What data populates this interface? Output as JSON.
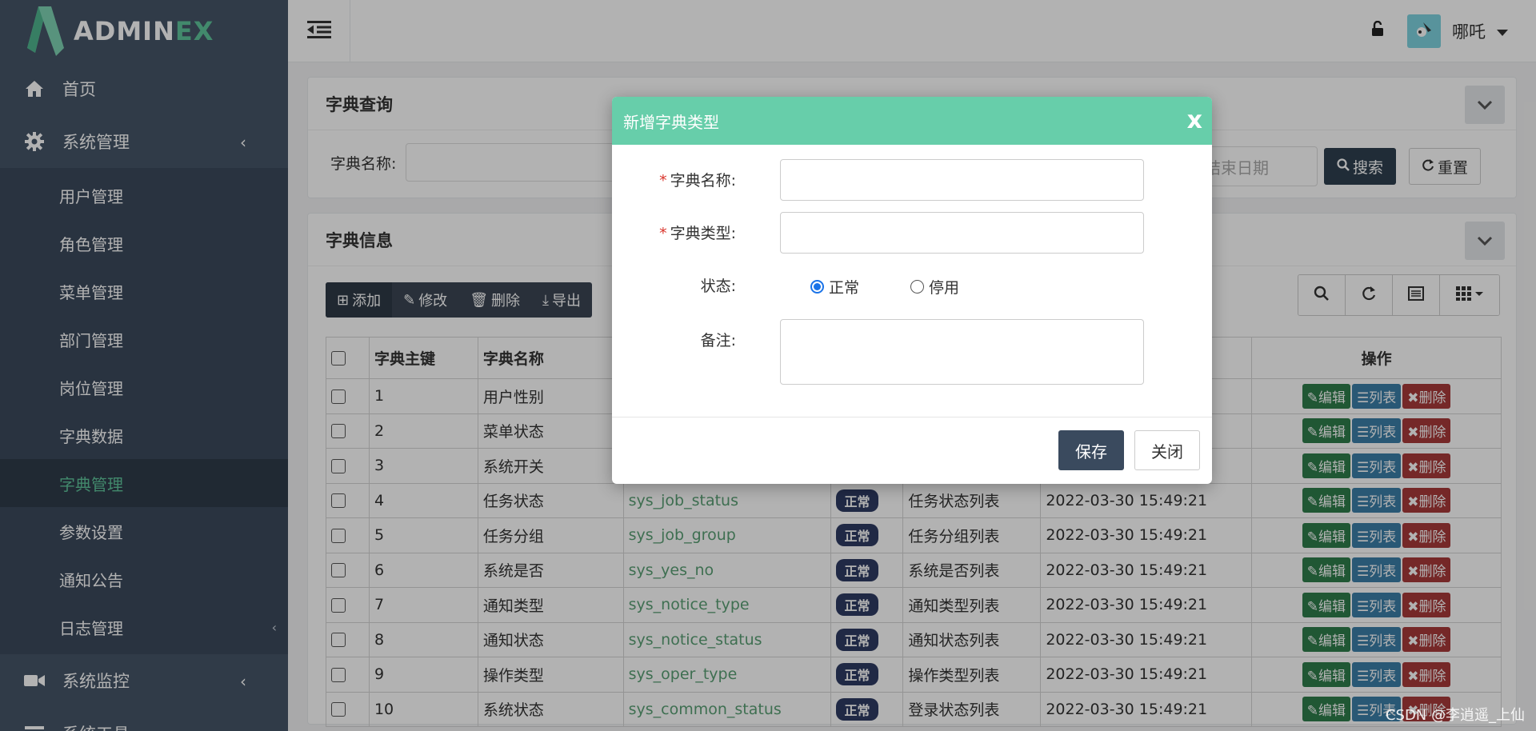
{
  "brand": {
    "name_main": "ADMIN",
    "name_accent": "EX"
  },
  "sidebar": {
    "items": [
      {
        "label": "首页",
        "icon": "home-icon"
      },
      {
        "label": "系统管理",
        "icon": "gear-icon",
        "expanded": true
      },
      {
        "label": "系统监控",
        "icon": "video-icon"
      },
      {
        "label": "系统工具",
        "icon": "bars-icon"
      }
    ],
    "sub_items": [
      {
        "label": "用户管理"
      },
      {
        "label": "角色管理"
      },
      {
        "label": "菜单管理"
      },
      {
        "label": "部门管理"
      },
      {
        "label": "岗位管理"
      },
      {
        "label": "字典数据"
      },
      {
        "label": "字典管理",
        "active": true
      },
      {
        "label": "参数设置"
      },
      {
        "label": "通知公告"
      },
      {
        "label": "日志管理"
      }
    ]
  },
  "header": {
    "username": "哪吒"
  },
  "search_panel": {
    "title": "字典查询",
    "field_label": "字典名称:",
    "end_date_placeholder": "结束日期",
    "search_btn": "搜索",
    "reset_btn": "重置"
  },
  "info_panel": {
    "title": "字典信息",
    "toolbar": {
      "add": "添加",
      "edit": "修改",
      "delete": "删除",
      "export": "导出"
    },
    "columns": {
      "id": "字典主键",
      "name": "字典名称",
      "op": "操作"
    },
    "row_actions": {
      "edit": "编辑",
      "list": "列表",
      "delete": "删除"
    },
    "rows": [
      {
        "id": "1",
        "name": "用户性别",
        "type": "",
        "status": "",
        "remark": "",
        "created": ""
      },
      {
        "id": "2",
        "name": "菜单状态",
        "type": "",
        "status": "",
        "remark": "",
        "created": ""
      },
      {
        "id": "3",
        "name": "系统开关",
        "type": "",
        "status": "",
        "remark": "",
        "created": ""
      },
      {
        "id": "4",
        "name": "任务状态",
        "type": "sys_job_status",
        "status": "正常",
        "remark": "任务状态列表",
        "created": "2022-03-30 15:49:21"
      },
      {
        "id": "5",
        "name": "任务分组",
        "type": "sys_job_group",
        "status": "正常",
        "remark": "任务分组列表",
        "created": "2022-03-30 15:49:21"
      },
      {
        "id": "6",
        "name": "系统是否",
        "type": "sys_yes_no",
        "status": "正常",
        "remark": "系统是否列表",
        "created": "2022-03-30 15:49:21"
      },
      {
        "id": "7",
        "name": "通知类型",
        "type": "sys_notice_type",
        "status": "正常",
        "remark": "通知类型列表",
        "created": "2022-03-30 15:49:21"
      },
      {
        "id": "8",
        "name": "通知状态",
        "type": "sys_notice_status",
        "status": "正常",
        "remark": "通知状态列表",
        "created": "2022-03-30 15:49:21"
      },
      {
        "id": "9",
        "name": "操作类型",
        "type": "sys_oper_type",
        "status": "正常",
        "remark": "操作类型列表",
        "created": "2022-03-30 15:49:21"
      },
      {
        "id": "10",
        "name": "系统状态",
        "type": "sys_common_status",
        "status": "正常",
        "remark": "登录状态列表",
        "created": "2022-03-30 15:49:21"
      }
    ]
  },
  "modal": {
    "title": "新增字典类型",
    "close_symbol": "x",
    "fields": {
      "name_label": "字典名称:",
      "name_value": "",
      "type_label": "字典类型:",
      "type_value": "",
      "status_label": "状态:",
      "status_options": [
        "正常",
        "停用"
      ],
      "status_selected": "正常",
      "remark_label": "备注:",
      "remark_value": ""
    },
    "required_mark": "*",
    "save_btn": "保存",
    "close_btn": "关闭"
  },
  "watermark": "CSDN @李逍遥_上仙",
  "colors": {
    "sidebar": "#455568",
    "accent": "#5fc49b",
    "modal_header": "#67ceaa",
    "primary_btn": "#2f4050"
  }
}
